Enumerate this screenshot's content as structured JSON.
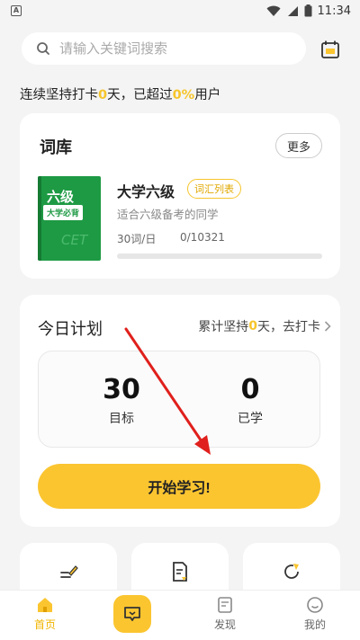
{
  "status_bar": {
    "app_icon": "A",
    "time": "11:34"
  },
  "search": {
    "placeholder": "请输入关键词搜索"
  },
  "streak": {
    "prefix": "连续坚持打卡",
    "days": "0",
    "middle": "天，已超过",
    "percent": "0%",
    "suffix": "用户"
  },
  "vocab": {
    "title": "词库",
    "more_label": "更多",
    "book": {
      "cover_title": "六级",
      "cover_tag": "大学必背",
      "cover_mark": "CET",
      "name": "大学六级",
      "tag": "词汇列表",
      "desc": "适合六级备考的同学",
      "daily": "30词/日",
      "progress_text": "0/10321",
      "progress_fraction": 0
    }
  },
  "plan": {
    "title": "今日计划",
    "checkin_prefix": "累计坚持",
    "checkin_days": "0",
    "checkin_suffix": "天，去打卡",
    "goal_value": "30",
    "goal_label": "目标",
    "learned_value": "0",
    "learned_label": "已学",
    "start_label": "开始学习!"
  },
  "nav": {
    "home": "首页",
    "discover": "发现",
    "mine": "我的"
  },
  "colors": {
    "accent": "#fbc530",
    "book_green": "#1e9a44",
    "annotation_arrow": "#e0201c"
  }
}
